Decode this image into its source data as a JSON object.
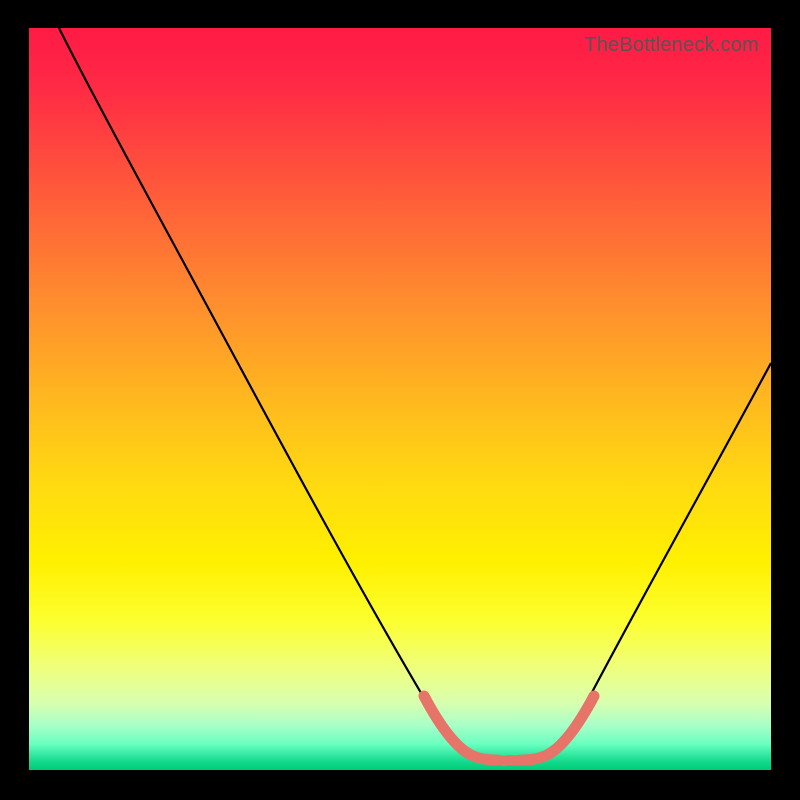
{
  "watermark": "TheBottleneck.com",
  "colors": {
    "black": "#000000",
    "curve_accent": "#e67468"
  },
  "chart_data": {
    "type": "line",
    "title": "",
    "xlabel": "",
    "ylabel": "",
    "xlim": [
      0,
      100
    ],
    "ylim": [
      0,
      100
    ],
    "grid": false,
    "series": [
      {
        "name": "bottleneck-curve",
        "x": [
          4,
          10,
          20,
          30,
          40,
          50,
          55,
          58,
          60,
          62,
          64,
          66,
          70,
          80,
          90,
          100
        ],
        "y": [
          100,
          88,
          70,
          53,
          36,
          18,
          9,
          4,
          1.5,
          0.8,
          0.8,
          1.5,
          6,
          22,
          40,
          58
        ]
      }
    ],
    "floor_segment": {
      "x": [
        55,
        68
      ],
      "y": [
        2.2,
        2.2
      ]
    }
  }
}
